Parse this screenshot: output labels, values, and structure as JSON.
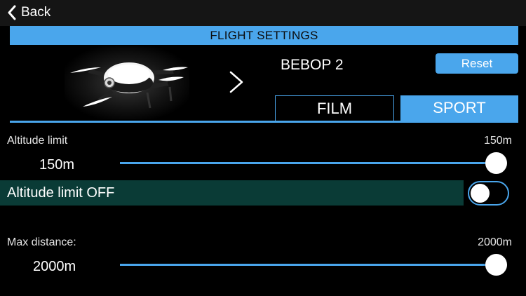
{
  "nav": {
    "back_label": "Back"
  },
  "header": {
    "title": "FLIGHT SETTINGS"
  },
  "drone": {
    "name": "BEBOP 2",
    "image_icon": "drone-image"
  },
  "reset_label": "Reset",
  "tabs": [
    {
      "label": "FILM",
      "selected": false
    },
    {
      "label": "SPORT",
      "selected": true
    }
  ],
  "altitude": {
    "label": "Altitude limit",
    "max_label": "150m",
    "value_label": "150m",
    "slider_fraction": 1.0
  },
  "altitude_off": {
    "label": "Altitude limit OFF",
    "enabled": false
  },
  "distance": {
    "label": "Max distance:",
    "max_label": "2000m",
    "value_label": "2000m",
    "slider_fraction": 1.0
  },
  "colors": {
    "accent": "#4aa6ec",
    "toggle_row_bg": "#0a3b36",
    "background": "#000000"
  }
}
